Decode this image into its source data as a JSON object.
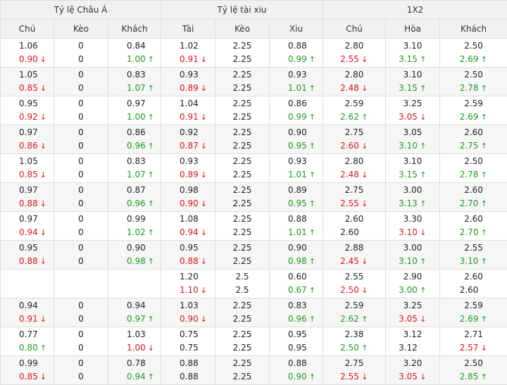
{
  "header": {
    "groups": [
      "Tỷ lệ Châu Á",
      "Tỷ lệ tài xiu",
      "1X2"
    ],
    "columns": [
      "Chú",
      "Kèo",
      "Khách",
      "Tài",
      "Kèo",
      "Xiu",
      "Chú",
      "Hòa",
      "Khách"
    ]
  },
  "rows": [
    [
      [
        "1.06",
        "0.90",
        "down"
      ],
      [
        "0",
        "0",
        "same"
      ],
      [
        "0.84",
        "1.00",
        "up"
      ],
      [
        "1.02",
        "0.91",
        "down"
      ],
      [
        "2.25",
        "2.25",
        "same"
      ],
      [
        "0.88",
        "0.99",
        "up"
      ],
      [
        "2.80",
        "2.55",
        "down"
      ],
      [
        "3.10",
        "3.15",
        "up"
      ],
      [
        "2.50",
        "2.69",
        "up"
      ]
    ],
    [
      [
        "1.05",
        "0.85",
        "down"
      ],
      [
        "0",
        "0",
        "same"
      ],
      [
        "0.83",
        "1.07",
        "up"
      ],
      [
        "0.93",
        "0.89",
        "down"
      ],
      [
        "2.25",
        "2.25",
        "same"
      ],
      [
        "0.93",
        "1.01",
        "up"
      ],
      [
        "2.80",
        "2.48",
        "down"
      ],
      [
        "3.10",
        "3.15",
        "up"
      ],
      [
        "2.50",
        "2.78",
        "up"
      ]
    ],
    [
      [
        "0.95",
        "0.92",
        "down"
      ],
      [
        "0",
        "0",
        "same"
      ],
      [
        "0.97",
        "1.00",
        "up"
      ],
      [
        "1.04",
        "0.91",
        "down"
      ],
      [
        "2.25",
        "2.25",
        "same"
      ],
      [
        "0.86",
        "0.99",
        "up"
      ],
      [
        "2.59",
        "2.62",
        "up"
      ],
      [
        "3.25",
        "3.05",
        "down"
      ],
      [
        "2.59",
        "2.69",
        "up"
      ]
    ],
    [
      [
        "0.97",
        "0.86",
        "down"
      ],
      [
        "0",
        "0",
        "same"
      ],
      [
        "0.86",
        "0.96",
        "up"
      ],
      [
        "0.92",
        "0.87",
        "down"
      ],
      [
        "2.25",
        "2.25",
        "same"
      ],
      [
        "0.90",
        "0.95",
        "up"
      ],
      [
        "2.75",
        "2.60",
        "down"
      ],
      [
        "3.05",
        "3.10",
        "up"
      ],
      [
        "2.60",
        "2.75",
        "up"
      ]
    ],
    [
      [
        "1.05",
        "0.85",
        "down"
      ],
      [
        "0",
        "0",
        "same"
      ],
      [
        "0.83",
        "1.07",
        "up"
      ],
      [
        "0.93",
        "0.89",
        "down"
      ],
      [
        "2.25",
        "2.25",
        "same"
      ],
      [
        "0.93",
        "1.01",
        "up"
      ],
      [
        "2.80",
        "2.48",
        "down"
      ],
      [
        "3.10",
        "3.15",
        "up"
      ],
      [
        "2.50",
        "2.78",
        "up"
      ]
    ],
    [
      [
        "0.97",
        "0.88",
        "down"
      ],
      [
        "0",
        "0",
        "same"
      ],
      [
        "0.87",
        "0.96",
        "up"
      ],
      [
        "0.98",
        "0.90",
        "down"
      ],
      [
        "2.25",
        "2.25",
        "same"
      ],
      [
        "0.89",
        "0.95",
        "up"
      ],
      [
        "2.75",
        "2.55",
        "down"
      ],
      [
        "3.00",
        "3.13",
        "up"
      ],
      [
        "2.60",
        "2.70",
        "up"
      ]
    ],
    [
      [
        "0.97",
        "0.94",
        "down"
      ],
      [
        "0",
        "0",
        "same"
      ],
      [
        "0.99",
        "1.02",
        "up"
      ],
      [
        "1.08",
        "0.94",
        "down"
      ],
      [
        "2.25",
        "2.25",
        "same"
      ],
      [
        "0.88",
        "1.01",
        "up"
      ],
      [
        "2.60",
        "2.60",
        "same"
      ],
      [
        "3.30",
        "3.10",
        "down"
      ],
      [
        "2.60",
        "2.70",
        "up"
      ]
    ],
    [
      [
        "0.95",
        "0.88",
        "down"
      ],
      [
        "0",
        "0",
        "same"
      ],
      [
        "0.90",
        "0.98",
        "up"
      ],
      [
        "0.95",
        "0.88",
        "down"
      ],
      [
        "2.25",
        "2.25",
        "same"
      ],
      [
        "0.90",
        "0.98",
        "up"
      ],
      [
        "2.88",
        "2.45",
        "down"
      ],
      [
        "3.00",
        "3.10",
        "up"
      ],
      [
        "2.55",
        "3.10",
        "up"
      ]
    ],
    [
      [
        "",
        "",
        "none"
      ],
      [
        "",
        "",
        "none"
      ],
      [
        "",
        "",
        "none"
      ],
      [
        "1.20",
        "1.10",
        "down"
      ],
      [
        "2.5",
        "2.5",
        "same"
      ],
      [
        "0.60",
        "0.67",
        "up"
      ],
      [
        "2.55",
        "2.50",
        "down"
      ],
      [
        "2.90",
        "3.00",
        "up"
      ],
      [
        "2.60",
        "2.60",
        "same"
      ]
    ],
    [
      [
        "0.94",
        "0.91",
        "down"
      ],
      [
        "0",
        "0",
        "same"
      ],
      [
        "0.94",
        "0.97",
        "up"
      ],
      [
        "1.03",
        "0.90",
        "down"
      ],
      [
        "2.25",
        "2.25",
        "same"
      ],
      [
        "0.83",
        "0.96",
        "up"
      ],
      [
        "2.59",
        "2.62",
        "up"
      ],
      [
        "3.25",
        "3.05",
        "down"
      ],
      [
        "2.59",
        "2.69",
        "up"
      ]
    ],
    [
      [
        "0.77",
        "0.80",
        "up"
      ],
      [
        "0",
        "0",
        "same"
      ],
      [
        "1.03",
        "1.00",
        "down"
      ],
      [
        "0.75",
        "0.75",
        "same"
      ],
      [
        "2.25",
        "2.25",
        "same"
      ],
      [
        "0.95",
        "0.95",
        "same"
      ],
      [
        "2.38",
        "2.50",
        "up"
      ],
      [
        "3.12",
        "3.12",
        "same"
      ],
      [
        "2.71",
        "2.57",
        "down"
      ]
    ],
    [
      [
        "0.99",
        "0.85",
        "down"
      ],
      [
        "0",
        "0",
        "same"
      ],
      [
        "0.78",
        "0.94",
        "up"
      ],
      [
        "0.88",
        "0.88",
        "same"
      ],
      [
        "2.25",
        "2.25",
        "same"
      ],
      [
        "0.88",
        "0.90",
        "up"
      ],
      [
        "2.75",
        "2.55",
        "down"
      ],
      [
        "3.20",
        "3.05",
        "down"
      ],
      [
        "2.50",
        "2.85",
        "up"
      ]
    ]
  ],
  "icons": {
    "up": "arrow-up-icon",
    "down": "arrow-down-icon"
  },
  "colors": {
    "up": "#1f9a1f",
    "down": "#e0161b",
    "header_bg": "#f1f1f1",
    "alt_row_bg": "#f6f6f6"
  }
}
